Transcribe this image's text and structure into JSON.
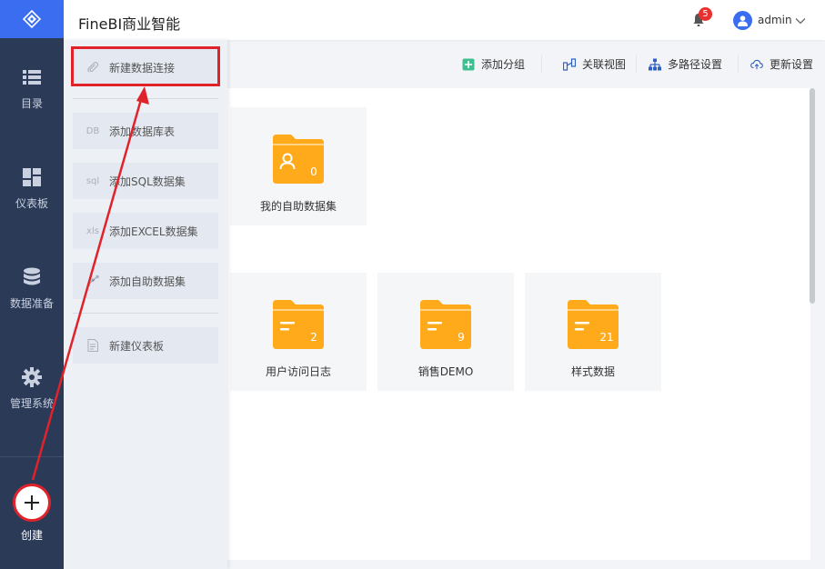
{
  "app": {
    "title": "FineBI商业智能"
  },
  "header": {
    "notification_count": "5",
    "username": "admin"
  },
  "nav": {
    "items": [
      {
        "label": "目录",
        "icon": "list-icon"
      },
      {
        "label": "仪表板",
        "icon": "dashboard-icon"
      },
      {
        "label": "数据准备",
        "icon": "database-icon"
      },
      {
        "label": "管理系统",
        "icon": "gear-icon"
      }
    ],
    "create_label": "创建"
  },
  "create_menu": {
    "items": [
      {
        "label": "新建数据连接",
        "icon": "paperclip-icon"
      },
      {
        "label": "添加数据库表",
        "icon": "db-icon"
      },
      {
        "label": "添加SQL数据集",
        "icon": "sql-icon"
      },
      {
        "label": "添加EXCEL数据集",
        "icon": "xls-icon"
      },
      {
        "label": "添加自助数据集",
        "icon": "self-service-icon"
      },
      {
        "label": "新建仪表板",
        "icon": "document-icon"
      }
    ],
    "icon_text": {
      "db": "DB",
      "sql": "sql",
      "xls": "xls"
    }
  },
  "toolbar": {
    "add_group": "添加分组",
    "relation_view": "关联视图",
    "multipath": "多路径设置",
    "update_settings": "更新设置"
  },
  "folders": [
    {
      "name": "我的自助数据集",
      "count": "0",
      "kind": "user"
    },
    {
      "name": "用户访问日志",
      "count": "2",
      "kind": "data"
    },
    {
      "name": "销售DEMO",
      "count": "9",
      "kind": "data"
    },
    {
      "name": "样式数据",
      "count": "21",
      "kind": "data"
    }
  ],
  "colors": {
    "nav_bg": "#2b3a57",
    "accent_blue": "#3a6df0",
    "folder_orange": "#ffaa1a",
    "highlight_red": "#e0232b"
  }
}
